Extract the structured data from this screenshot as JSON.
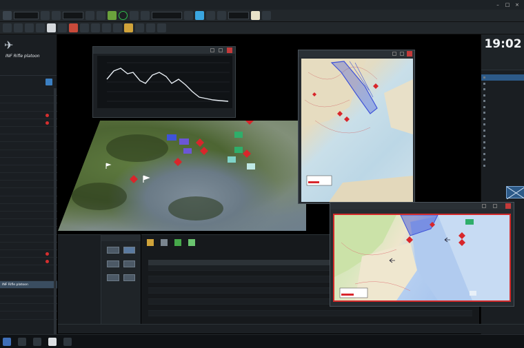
{
  "titlebar": {
    "text": "",
    "minimize": "–",
    "maximize": "□",
    "close": "×"
  },
  "toolbar": {
    "layer_select": "",
    "scale_select": "",
    "view_select": "",
    "zoom_select": ""
  },
  "left_panel": {
    "title": "INF Rifle platoon",
    "tabs": [
      "",
      ""
    ],
    "items": [
      {
        "label": "",
        "dot": false
      },
      {
        "label": "",
        "dot": false
      },
      {
        "label": "",
        "dot": false
      },
      {
        "label": "",
        "dot": true
      },
      {
        "label": "",
        "dot": true
      },
      {
        "label": "",
        "dot": false
      },
      {
        "label": "",
        "dot": false
      },
      {
        "label": "",
        "dot": false
      },
      {
        "label": "",
        "dot": false
      },
      {
        "label": "",
        "dot": false
      },
      {
        "label": "",
        "dot": false
      },
      {
        "label": "",
        "dot": false
      },
      {
        "label": "",
        "dot": false
      },
      {
        "label": "",
        "dot": false
      },
      {
        "label": "",
        "dot": false
      },
      {
        "label": "",
        "dot": false
      },
      {
        "label": "",
        "dot": false
      },
      {
        "label": "",
        "dot": false
      },
      {
        "label": "",
        "dot": false
      },
      {
        "label": "",
        "dot": false
      },
      {
        "label": "",
        "dot": false
      },
      {
        "label": "",
        "dot": true
      },
      {
        "label": "",
        "dot": true
      },
      {
        "label": "",
        "dot": false
      },
      {
        "label": "",
        "dot": false
      },
      {
        "label": "INF Rifle platoon",
        "dot": false,
        "selected": true
      },
      {
        "label": "",
        "dot": false
      },
      {
        "label": "",
        "dot": false
      },
      {
        "label": "",
        "dot": false
      },
      {
        "label": "",
        "dot": false
      }
    ]
  },
  "profile_window": {
    "title": "",
    "x_label": "",
    "y_label": "",
    "foot_left": "",
    "foot_right": ""
  },
  "view1": {
    "title": ""
  },
  "view2": {
    "title": ""
  },
  "right_panel": {
    "clock_label": "",
    "clock_time": "19:02",
    "clock_date": "",
    "items": [
      {
        "label": "",
        "hl": true
      },
      {
        "label": "",
        "hl": false
      },
      {
        "label": "",
        "hl": false
      },
      {
        "label": "",
        "hl": false
      },
      {
        "label": "",
        "hl": false
      },
      {
        "label": "",
        "hl": false
      },
      {
        "label": "",
        "hl": false
      },
      {
        "label": "",
        "hl": false
      },
      {
        "label": "",
        "hl": false
      },
      {
        "label": "",
        "hl": false
      },
      {
        "label": "",
        "hl": false
      },
      {
        "label": "",
        "hl": false
      },
      {
        "label": "",
        "hl": false
      },
      {
        "label": "",
        "hl": false
      },
      {
        "label": "",
        "hl": false
      },
      {
        "label": "",
        "hl": false
      }
    ]
  },
  "bottom_left": {
    "lines": [
      "",
      "",
      "",
      "",
      "",
      "",
      "",
      "",
      ""
    ]
  },
  "properties": {
    "title": ""
  },
  "log": {
    "columns": [
      "",
      "",
      "",
      "",
      ""
    ],
    "rows": [
      [
        "",
        "",
        "",
        "",
        ""
      ],
      [
        "",
        "",
        "",
        "",
        ""
      ],
      [
        "",
        "",
        "",
        "",
        ""
      ],
      [
        "",
        "",
        "",
        "",
        ""
      ],
      [
        "",
        "",
        "",
        "",
        ""
      ],
      [
        "",
        "",
        "",
        "",
        ""
      ],
      [
        "",
        "",
        "",
        "",
        ""
      ],
      [
        "",
        "",
        "",
        "",
        ""
      ],
      [
        "",
        "",
        "",
        "",
        ""
      ]
    ]
  },
  "statusbar": {
    "left": "",
    "right": ""
  },
  "taskbar": {
    "tray": ""
  },
  "colors": {
    "hostile": "#d8262b",
    "friendly": "#3f53d8",
    "neutral": "#2fae6a",
    "selection_border": "#d42a2a",
    "accent": "#2d5a88"
  }
}
